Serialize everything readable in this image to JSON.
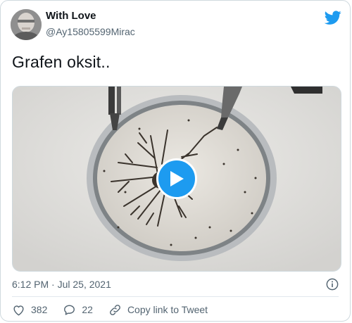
{
  "tweet": {
    "display_name": "With Love",
    "handle": "@Ay15805599Mirac",
    "text": "Grafen oksit..",
    "timestamp": "6:12 PM · Jul 25, 2021"
  },
  "actions": {
    "likes": "382",
    "replies": "22",
    "copy_link": "Copy link to Tweet"
  },
  "icons": {
    "brand": "twitter-bird-icon",
    "play": "play-icon",
    "info": "info-icon",
    "like": "heart-icon",
    "reply": "speech-bubble-icon",
    "copy": "link-icon"
  },
  "colors": {
    "accent": "#1d9bf0",
    "text": "#0f1419",
    "secondary": "#536471",
    "border": "#cfd9de"
  }
}
